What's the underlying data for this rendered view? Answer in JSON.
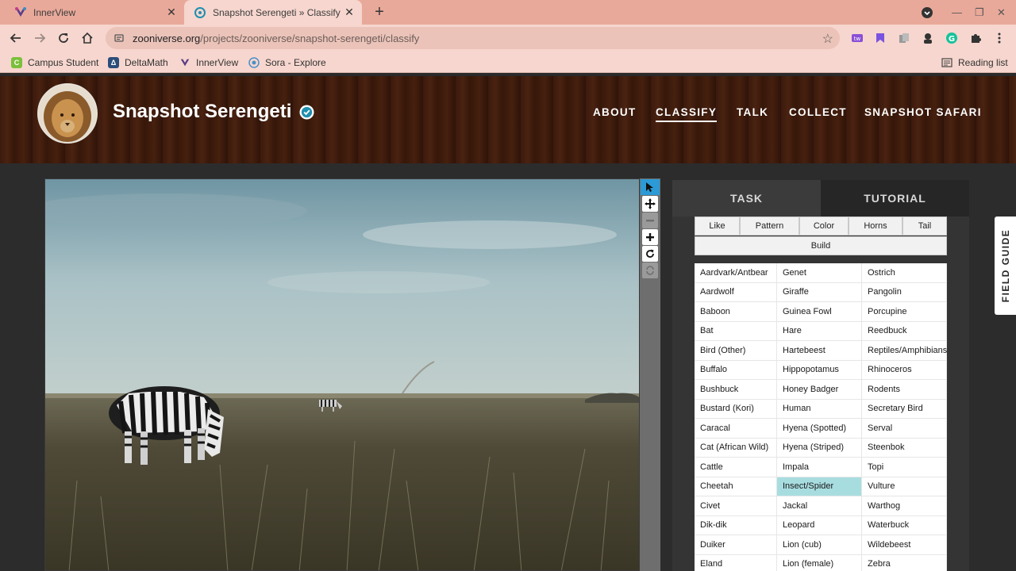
{
  "browser": {
    "tabs": [
      {
        "title": "InnerView",
        "icon": "innerview-favicon"
      },
      {
        "title": "Snapshot Serengeti » Classify — Zooniverse",
        "icon": "zooniverse-favicon"
      }
    ],
    "url_domain": "zooniverse.org",
    "url_path": "/projects/zooniverse/snapshot-serengeti/classify",
    "bookmarks": [
      {
        "label": "Campus Student",
        "icon": "campus-icon",
        "color": "#7bbf3a"
      },
      {
        "label": "DeltaMath",
        "icon": "deltamath-icon",
        "color": "#2b4d7a"
      },
      {
        "label": "InnerView",
        "icon": "innerview-icon",
        "color": "#5a3d8a"
      },
      {
        "label": "Sora - Explore",
        "icon": "sora-icon",
        "color": "#4a90c8"
      }
    ],
    "reading_list": "Reading list"
  },
  "site": {
    "title": "Snapshot Serengeti",
    "nav": [
      "ABOUT",
      "CLASSIFY",
      "TALK",
      "COLLECT",
      "SNAPSHOT SAFARI"
    ],
    "active_nav": "CLASSIFY"
  },
  "panel": {
    "tabs": [
      "TASK",
      "TUTORIAL"
    ],
    "filters": [
      "Like",
      "Pattern",
      "Color",
      "Horns",
      "Tail"
    ],
    "filter_build": "Build",
    "species": [
      "Aardvark/Antbear",
      "Genet",
      "Ostrich",
      "Aardwolf",
      "Giraffe",
      "Pangolin",
      "Baboon",
      "Guinea Fowl",
      "Porcupine",
      "Bat",
      "Hare",
      "Reedbuck",
      "Bird (Other)",
      "Hartebeest",
      "Reptiles/Amphibians",
      "Buffalo",
      "Hippopotamus",
      "Rhinoceros",
      "Bushbuck",
      "Honey Badger",
      "Rodents",
      "Bustard (Kori)",
      "Human",
      "Secretary Bird",
      "Caracal",
      "Hyena (Spotted)",
      "Serval",
      "Cat (African Wild)",
      "Hyena (Striped)",
      "Steenbok",
      "Cattle",
      "Impala",
      "Topi",
      "Cheetah",
      "Insect/Spider",
      "Vulture",
      "Civet",
      "Jackal",
      "Warthog",
      "Dik-dik",
      "Leopard",
      "Waterbuck",
      "Duiker",
      "Lion (cub)",
      "Wildebeest",
      "Eland",
      "Lion (female)",
      "Zebra"
    ],
    "selected_species": "Insect/Spider",
    "field_guide": "FIELD GUIDE"
  },
  "colors": {
    "accent": "#2b9ad6",
    "selected": "#a8dde0",
    "verified": "#1f8fb0"
  }
}
